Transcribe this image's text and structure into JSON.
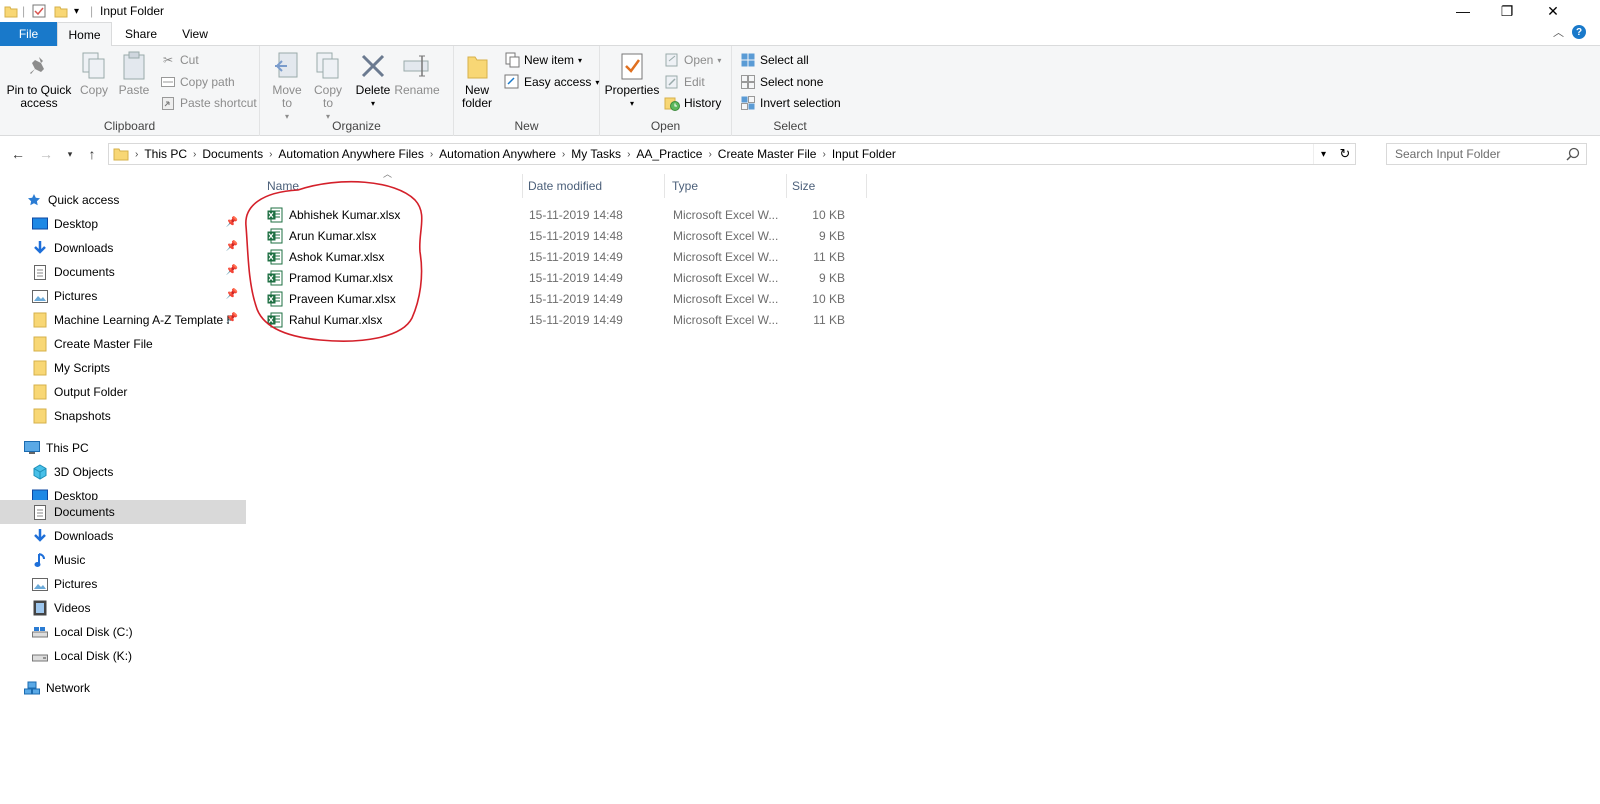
{
  "window": {
    "title": "Input Folder",
    "controls": {
      "minimize": "—",
      "maximize": "❐",
      "close": "✕"
    }
  },
  "ribbon_tabs": {
    "file": "File",
    "home": "Home",
    "share": "Share",
    "view": "View"
  },
  "ribbon": {
    "clipboard": {
      "label": "Clipboard",
      "pin_quick_access": "Pin to Quick access",
      "copy": "Copy",
      "paste": "Paste",
      "cut": "Cut",
      "copy_path": "Copy path",
      "paste_shortcut": "Paste shortcut"
    },
    "organize": {
      "label": "Organize",
      "move_to": "Move to",
      "copy_to": "Copy to",
      "delete": "Delete",
      "rename": "Rename"
    },
    "new": {
      "label": "New",
      "new_folder": "New folder",
      "new_item": "New item",
      "easy_access": "Easy access"
    },
    "open": {
      "label": "Open",
      "properties": "Properties",
      "open": "Open",
      "edit": "Edit",
      "history": "History"
    },
    "select": {
      "label": "Select",
      "select_all": "Select all",
      "select_none": "Select none",
      "invert_selection": "Invert selection"
    }
  },
  "address": {
    "breadcrumbs": [
      "This PC",
      "Documents",
      "Automation Anywhere Files",
      "Automation Anywhere",
      "My Tasks",
      "AA_Practice",
      "Create Master File",
      "Input Folder"
    ],
    "search_placeholder": "Search Input Folder"
  },
  "sidebar": {
    "quick_access": {
      "label": "Quick access",
      "items": [
        {
          "label": "Desktop",
          "icon": "desktop-icon",
          "pinned": true
        },
        {
          "label": "Downloads",
          "icon": "download-icon",
          "pinned": true
        },
        {
          "label": "Documents",
          "icon": "documents-icon",
          "pinned": true
        },
        {
          "label": "Pictures",
          "icon": "pictures-icon",
          "pinned": true
        },
        {
          "label": "Machine Learning A-Z Template F",
          "icon": "folder-icon",
          "pinned": true
        },
        {
          "label": "Create Master File",
          "icon": "folder-icon",
          "pinned": false
        },
        {
          "label": "My Scripts",
          "icon": "folder-icon",
          "pinned": false
        },
        {
          "label": "Output Folder",
          "icon": "folder-icon",
          "pinned": false
        },
        {
          "label": "Snapshots",
          "icon": "folder-icon",
          "pinned": false
        }
      ]
    },
    "this_pc": {
      "label": "This PC",
      "items": [
        {
          "label": "3D Objects",
          "icon": "cube-icon"
        },
        {
          "label": "Desktop",
          "icon": "desktop-icon"
        },
        {
          "label": "Documents",
          "icon": "documents-icon",
          "selected": true
        },
        {
          "label": "Downloads",
          "icon": "download-icon"
        },
        {
          "label": "Music",
          "icon": "music-icon"
        },
        {
          "label": "Pictures",
          "icon": "pictures-icon"
        },
        {
          "label": "Videos",
          "icon": "video-icon"
        },
        {
          "label": "Local Disk (C:)",
          "icon": "drive-icon"
        },
        {
          "label": "Local Disk (K:)",
          "icon": "drive-icon"
        }
      ]
    },
    "network": {
      "label": "Network"
    }
  },
  "file_list": {
    "columns": {
      "name": "Name",
      "date": "Date modified",
      "type": "Type",
      "size": "Size"
    },
    "files": [
      {
        "name": "Abhishek Kumar.xlsx",
        "date": "15-11-2019 14:48",
        "type": "Microsoft Excel W...",
        "size": "10 KB"
      },
      {
        "name": "Arun Kumar.xlsx",
        "date": "15-11-2019 14:48",
        "type": "Microsoft Excel W...",
        "size": "9 KB"
      },
      {
        "name": "Ashok Kumar.xlsx",
        "date": "15-11-2019 14:49",
        "type": "Microsoft Excel W...",
        "size": "11 KB"
      },
      {
        "name": "Pramod Kumar.xlsx",
        "date": "15-11-2019 14:49",
        "type": "Microsoft Excel W...",
        "size": "9 KB"
      },
      {
        "name": "Praveen Kumar.xlsx",
        "date": "15-11-2019 14:49",
        "type": "Microsoft Excel W...",
        "size": "10 KB"
      },
      {
        "name": "Rahul Kumar.xlsx",
        "date": "15-11-2019 14:49",
        "type": "Microsoft Excel W...",
        "size": "11 KB"
      }
    ]
  },
  "colors": {
    "file_tab": "#1979ca",
    "ribbon_bg": "#f5f6f7",
    "selected_nav": "#d9d9d9",
    "header_text": "#4c607a",
    "annotation": "#d4202a"
  }
}
